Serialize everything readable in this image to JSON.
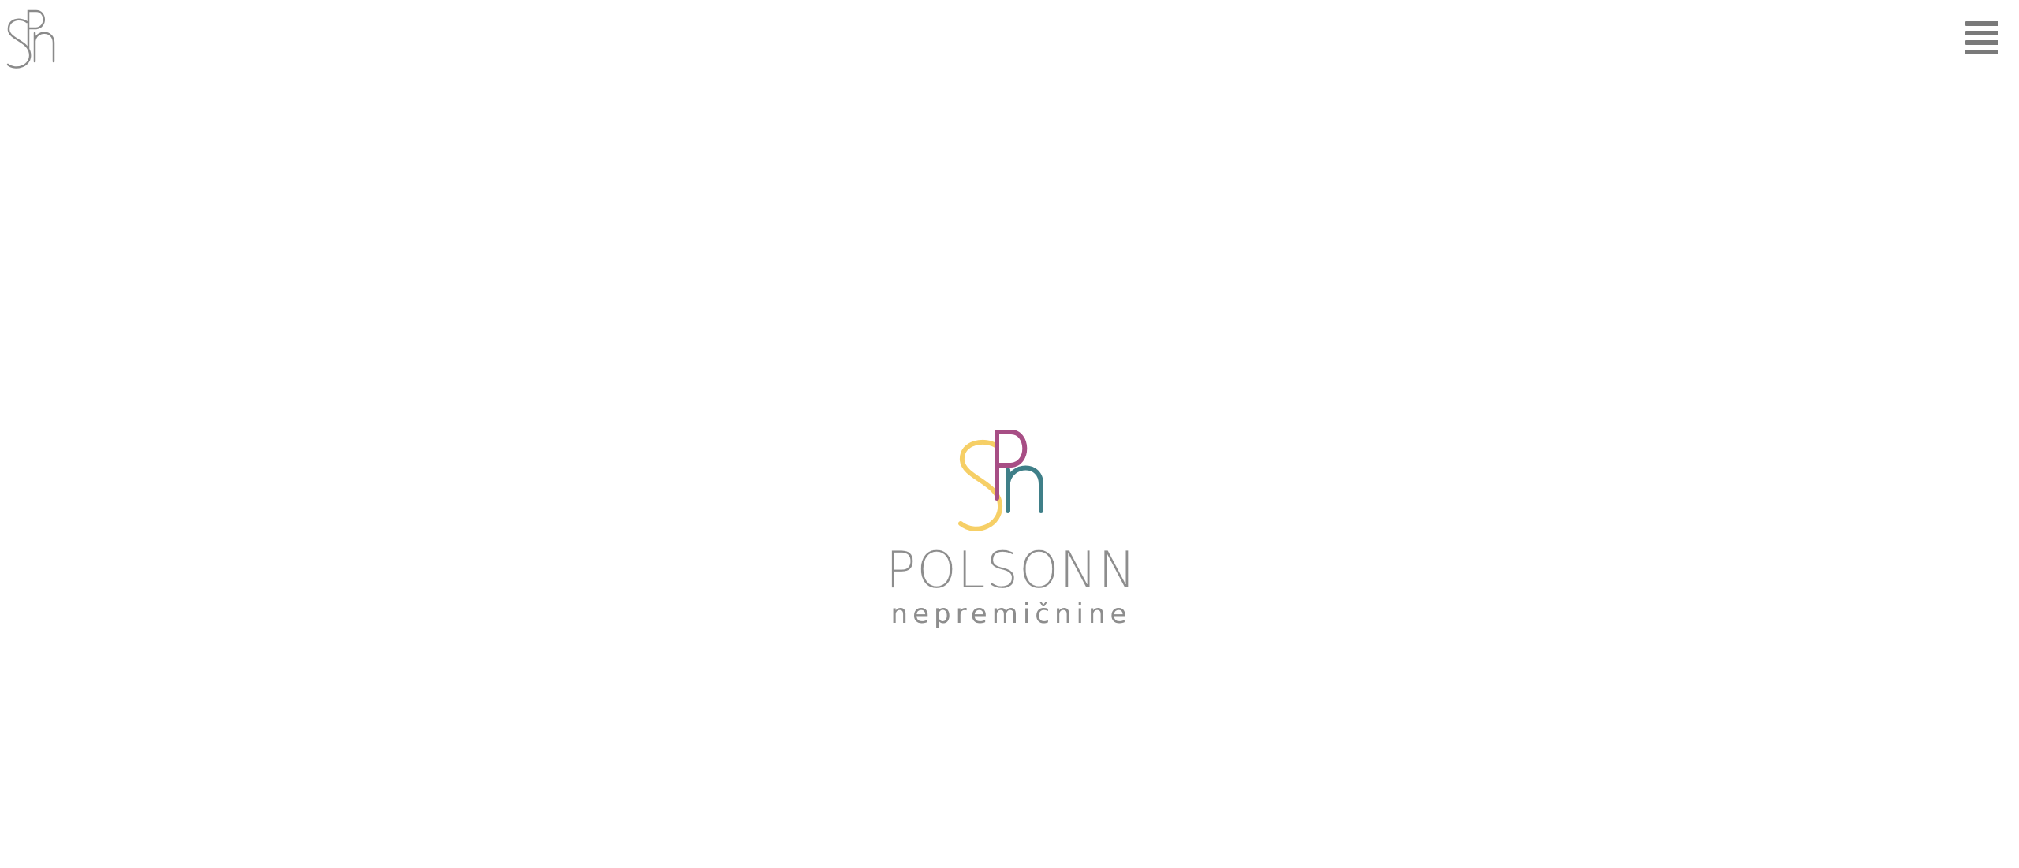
{
  "header": {
    "logo_icon": "spn-monogram-logo",
    "menu_icon": "hamburger-menu-icon"
  },
  "brand": {
    "name": "POLSONN",
    "subtitle": "nepremičnine",
    "colors": {
      "s_letter": "#f6cf66",
      "p_letter": "#a74e85",
      "n_letter": "#3f7f88",
      "text": "#8d8d8d",
      "top_logo": "#8a8a8a"
    }
  }
}
